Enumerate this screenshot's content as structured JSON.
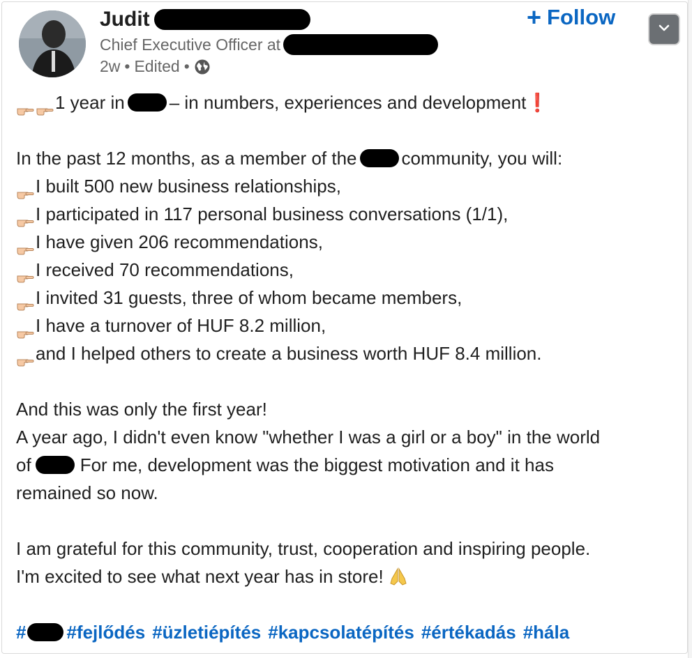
{
  "author": {
    "name": "Judit",
    "headline": "Chief Executive Officer at",
    "time": "2w",
    "edited": "Edited",
    "separator": "•"
  },
  "actions": {
    "follow_label": "Follow",
    "follow_plus": "+"
  },
  "post": {
    "title_prefix": "1 year in",
    "title_suffix": "– in numbers, experiences and development",
    "title_mark": "❗",
    "intro_prefix": "In the past 12 months, as a member of the",
    "intro_suffix": "community, you will:",
    "bullets": [
      "I built 500 new business relationships,",
      "I participated in 117 personal business conversations (1/1),",
      "I have given 206 recommendations,",
      "I received 70 recommendations,",
      "I invited 31 guests, three of whom became members,",
      "I have a turnover of HUF 8.2 million,",
      "and I helped others to create a business worth HUF 8.4 million."
    ],
    "para2_line1": "And this was only the first year!",
    "para2_line2": "A year ago, I didn't even know \"whether I was a girl or a boy\" in the world",
    "para2_line3_prefix": "of",
    "para2_line3_suffix": "For me, development was the biggest motivation and it has",
    "para2_line4": "remained so now.",
    "para3_line1": "I am grateful for this community, trust, cooperation and inspiring people.",
    "para3_line2": "I'm excited to see what next year has in store!",
    "hashtag_hash": "#",
    "hashtags": [
      "#fejlődés",
      "#üzletiépítés",
      "#kapcsolatépítés",
      "#értékadás",
      "#hála"
    ]
  },
  "colors": {
    "link": "#0a66c2",
    "text": "#1f1f1f",
    "muted": "#666666",
    "redaction": "#000000"
  },
  "icons": [
    "globe-icon",
    "chevron-down-icon",
    "pointing-hand-icon",
    "folded-hands-icon",
    "exclamation-icon"
  ]
}
